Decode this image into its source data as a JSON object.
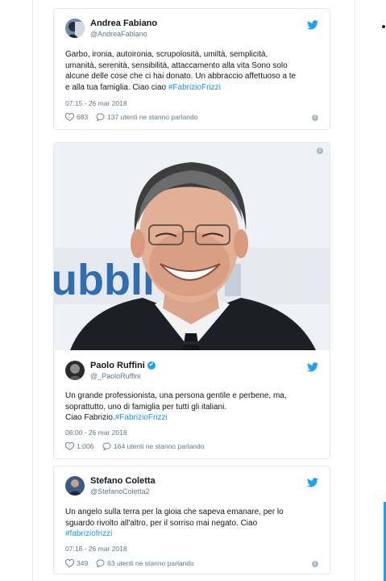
{
  "tweets": [
    {
      "name": "Andrea Fabiano",
      "handle": "@AndreaFabiano",
      "text_lines": [
        "Garbo, ironia, autoironia, scrupolosità, umiltà, semplicità,",
        "umanità, serenità, sensibilità, attaccamento alla vita Sono solo",
        "alcune delle cose che ci hai donato. Un abbraccio affettuoso a te",
        "e alla tua famiglia. Ciao ciao "
      ],
      "hashtag": "#FabrizioFrizzi",
      "date": "07:15 - 26 mar 2018",
      "likes": "683",
      "talking": "137 utenti ne stanno parlando"
    },
    {
      "name": "Paolo Ruffini",
      "handle": "@_PaoloRuffini",
      "verified": "✔",
      "text_lines": [
        "Un grande professionista, una persona gentile e perbene, ma,",
        "soprattutto, uno di famiglia per tutti gli italiani.",
        "Ciao Fabrizio."
      ],
      "hashtag": "#FabrizioFrizzi",
      "date": "08:00 - 26 mar 2018",
      "likes": "1.006",
      "talking": "164 utenti ne stanno parlando",
      "photo_backdrop_text": "ubbli"
    },
    {
      "name": "Stefano Coletta",
      "handle": "@StefanoColetta2",
      "text_lines": [
        "Un angelo sulla terra per la gioia che sapeva emanare, per lo",
        "sguardo rivolto all'altro, per il sorriso mai negato. Ciao"
      ],
      "hashtag": "#fabriziofrizzi",
      "date": "07:18 - 26 mar 2018",
      "likes": "349",
      "talking": "63 utenti ne stanno parlando"
    }
  ],
  "colors": {
    "accent": "#1da1f2",
    "hashtag": "#1b95e0",
    "text": "#14171a",
    "muted": "#657786",
    "border": "#e1e8ed"
  },
  "icons": {
    "bird": "twitter-bird-icon",
    "heart": "heart-icon",
    "reply": "speech-bubble-icon",
    "info": "info-icon"
  },
  "info_glyph": "i"
}
